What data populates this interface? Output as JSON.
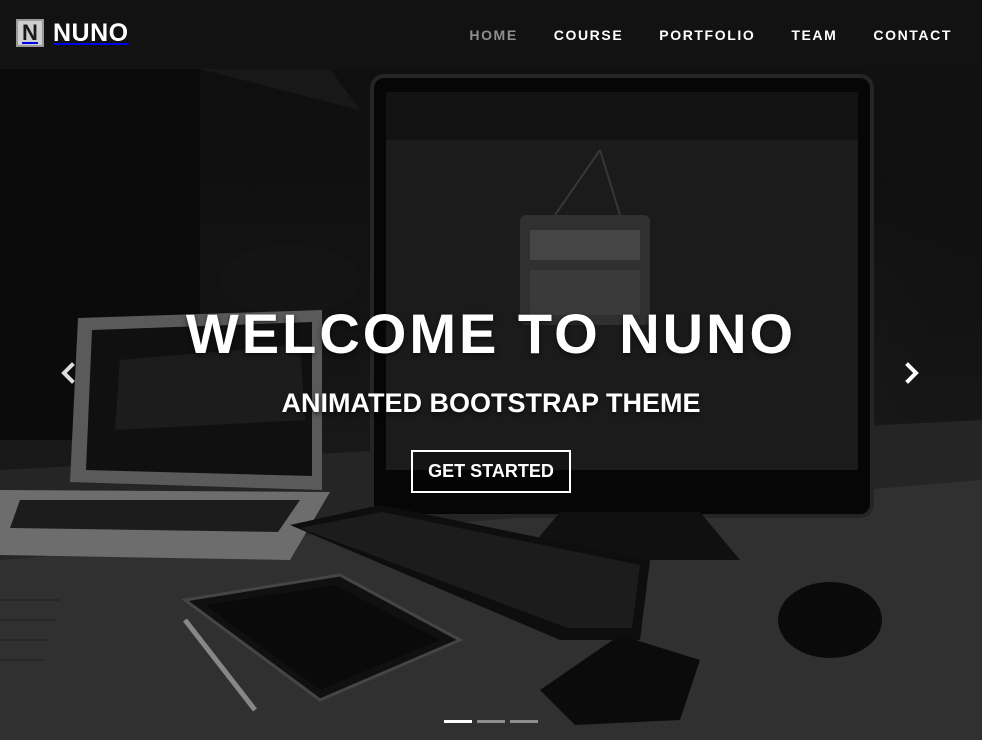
{
  "brand": {
    "logo_letter": "N",
    "name": "NUNO"
  },
  "nav": {
    "items": [
      {
        "label": "HOME",
        "active": true
      },
      {
        "label": "COURSE",
        "active": false
      },
      {
        "label": "PORTFOLIO",
        "active": false
      },
      {
        "label": "TEAM",
        "active": false
      },
      {
        "label": "CONTACT",
        "active": false
      }
    ]
  },
  "hero": {
    "title": "WELCOME TO NUNO",
    "subtitle": "ANIMATED BOOTSTRAP THEME",
    "cta_label": "GET STARTED"
  },
  "carousel": {
    "prev_icon": "chevron-left-icon",
    "next_icon": "chevron-right-icon",
    "slide_count": 3,
    "active_slide": 1
  },
  "colors": {
    "nav_active": "#8f8f8f",
    "nav_text": "#ffffff",
    "overlay": "#141414"
  }
}
